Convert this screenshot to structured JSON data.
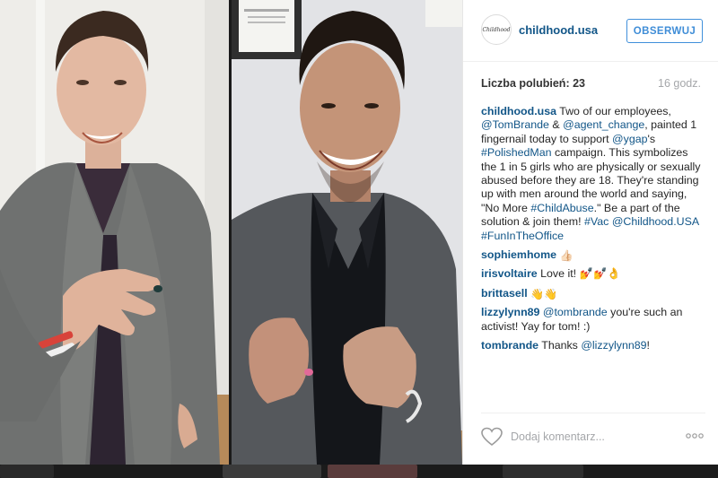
{
  "post": {
    "username": "childhood.usa",
    "avatar_text": "Childhood",
    "follow_label": "OBSERWUJ",
    "likes_text": "Liczba polubień: 23",
    "time_ago": "16 godz."
  },
  "caption": {
    "author": "childhood.usa",
    "t1": "Two of our employees,",
    "m1": "@TomBrande",
    "t2": "&",
    "m2": "@agent_change",
    "t3": ", painted 1 fingernail today to support",
    "m3": "@ygap",
    "t4": "'s",
    "h1": "#PolishedMan",
    "t5": "campaign. This symbolizes the 1 in 5 girls who are physically or sexually abused before they are 18. They're standing up with men around the world and saying, \"No More",
    "h2": "#ChildAbuse",
    "t6": ".\" Be a part of the solution & join them!",
    "h3": "#Vac",
    "m4": "@Childhood.USA",
    "h4": "#FunInTheOffice"
  },
  "comments": [
    {
      "user": "sophiemhome",
      "text": "👍🏻"
    },
    {
      "user": "irisvoltaire",
      "text": "Love it! 💅💅👌"
    },
    {
      "user": "brittasell",
      "text": "👋👋"
    },
    {
      "user": "lizzylynn89",
      "mention": "@tombrande",
      "text": "you're such an activist! Yay for tom! :)"
    },
    {
      "user": "tombrande",
      "pre": "Thanks",
      "mention": "@lizzylynn89",
      "text": "!"
    }
  ],
  "footer": {
    "add_comment_placeholder": "Dodaj komentarz...",
    "like_icon": "heart-outline-icon",
    "more_icon": "more-options-icon"
  },
  "colors": {
    "link": "#125688",
    "follow": "#3f8dd7",
    "muted": "#a5a7aa"
  }
}
